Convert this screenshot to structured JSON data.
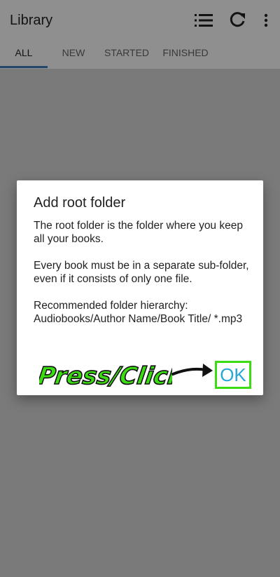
{
  "appbar": {
    "title": "Library"
  },
  "tabs": [
    {
      "label": "ALL",
      "active": true
    },
    {
      "label": "NEW",
      "active": false
    },
    {
      "label": "STARTED",
      "active": false
    },
    {
      "label": "FINISHED",
      "active": false
    }
  ],
  "dialog": {
    "title": "Add root folder",
    "paragraphs": [
      "The root folder is the folder where you keep all your books.",
      "Every book must be in a separate sub-folder, even if it consists of only one file.",
      "Recommended folder hierarchy: Audiobooks/Author Name/Book Title/ *.mp3"
    ],
    "annotation_text": "Press/Click",
    "ok_label": "OK"
  },
  "colors": {
    "annotation_green": "#3bdc12",
    "ok_blue": "#2aa6d6",
    "tab_indicator": "#3f7fbf"
  },
  "icons": [
    "list-icon",
    "refresh-icon",
    "more-vert-icon",
    "arrow-right-icon"
  ]
}
